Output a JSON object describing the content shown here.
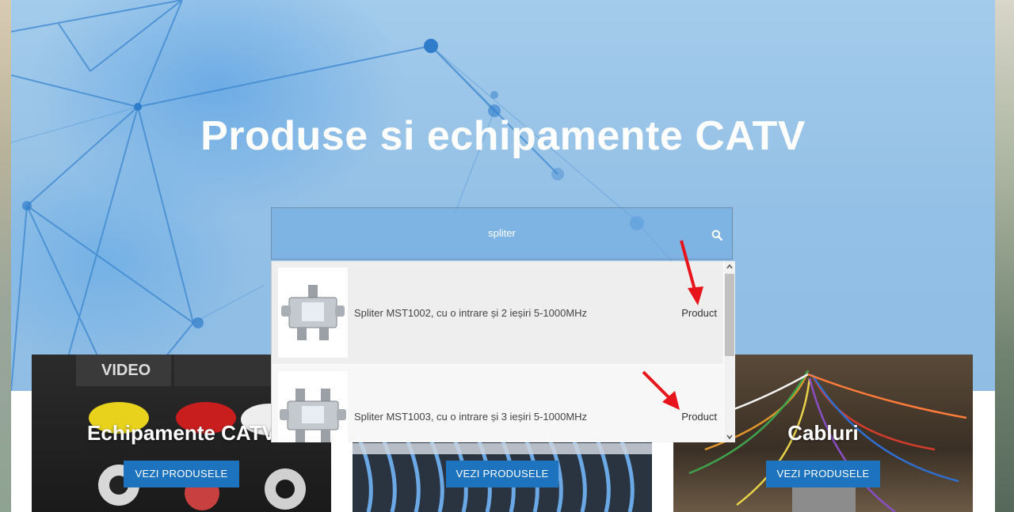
{
  "hero": {
    "title": "Produse si echipamente CATV"
  },
  "search": {
    "query": "spliter",
    "icon": "search-icon"
  },
  "results": [
    {
      "title": "Spliter MST1002, cu o intrare și 2 ieșiri 5-1000MHz",
      "type": "Product",
      "outputs": 2
    },
    {
      "title": "Spliter MST1003, cu o intrare și 3 ieșiri 5-1000MHz",
      "type": "Product",
      "outputs": 3
    }
  ],
  "cards": [
    {
      "title": "Echipamente CATV",
      "button": "VEZI PRODUSELE"
    },
    {
      "title": "",
      "button": "VEZI PRODUSELE"
    },
    {
      "title": "Cabluri",
      "button": "VEZI PRODUSELE"
    }
  ],
  "colors": {
    "accent_button": "#1e73be",
    "annotation_arrow": "#e8141b",
    "hero_blue": "#93c0e6"
  }
}
